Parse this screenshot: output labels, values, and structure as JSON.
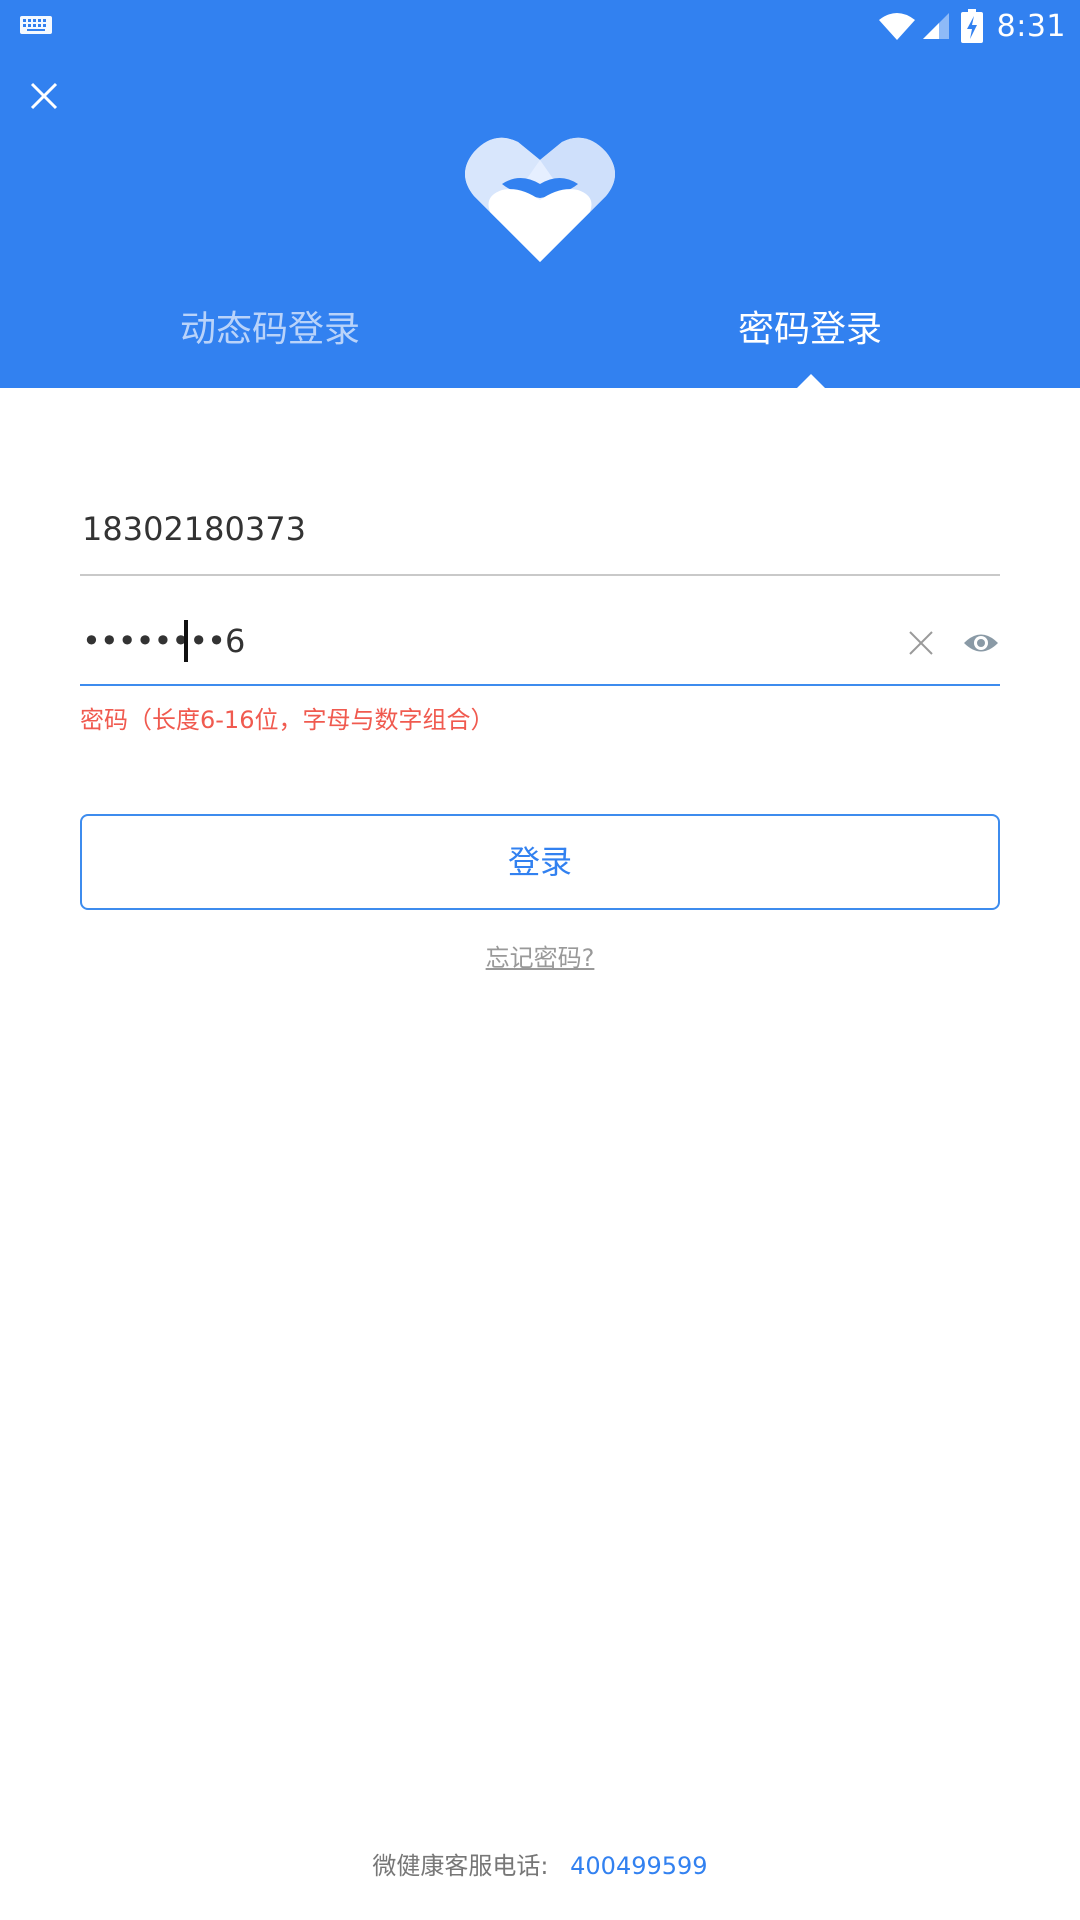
{
  "status_bar": {
    "time": "8:31",
    "icons": [
      "keyboard-icon",
      "wifi-icon",
      "signal-icon",
      "battery-charging-icon"
    ]
  },
  "header": {
    "close_icon": "close-icon",
    "logo_icon": "heart-logo-icon",
    "tabs": [
      {
        "label": "动态码登录",
        "active": false
      },
      {
        "label": "密码登录",
        "active": true
      }
    ]
  },
  "form": {
    "phone": {
      "value": "18302180373"
    },
    "password": {
      "value": "••••••••6",
      "clear_icon": "clear-icon",
      "toggle_icon": "eye-icon"
    },
    "error": "密码（长度6-16位，字母与数字组合）"
  },
  "login_button": {
    "label": "登录"
  },
  "forgot_link": {
    "label": "忘记密码?"
  },
  "footer": {
    "label": "微健康客服电话:",
    "phone": "400499599"
  },
  "colors": {
    "primary": "#3281f0",
    "error": "#f05a4f",
    "input_line": "#c9c9c9",
    "focus_line": "#3d8cee"
  }
}
